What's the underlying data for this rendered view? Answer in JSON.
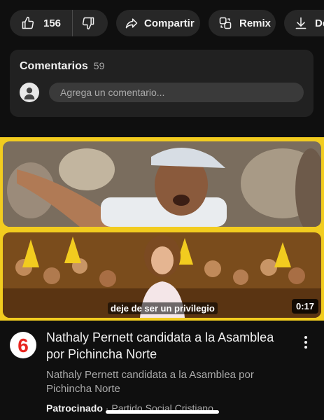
{
  "actions": {
    "like_count": "156",
    "share_label": "Compartir",
    "remix_label": "Remix",
    "download_label": "Des"
  },
  "comments": {
    "title": "Comentarios",
    "count": "59",
    "placeholder": "Agrega un comentario..."
  },
  "ad": {
    "caption": "deje de ser un privilegio",
    "duration": "0:17",
    "title": "Nathaly Pernett candidata a la Asamblea por Pichincha Norte",
    "description": "Nathaly Pernett candidata a la Asamblea por Pichincha Norte",
    "sponsored_label": "Patrocinado",
    "separator": "·",
    "advertiser": "Partido Social Cristiano",
    "logo_text": "6",
    "accent_color": "#f2cc1f",
    "logo_color": "#e8251f"
  }
}
